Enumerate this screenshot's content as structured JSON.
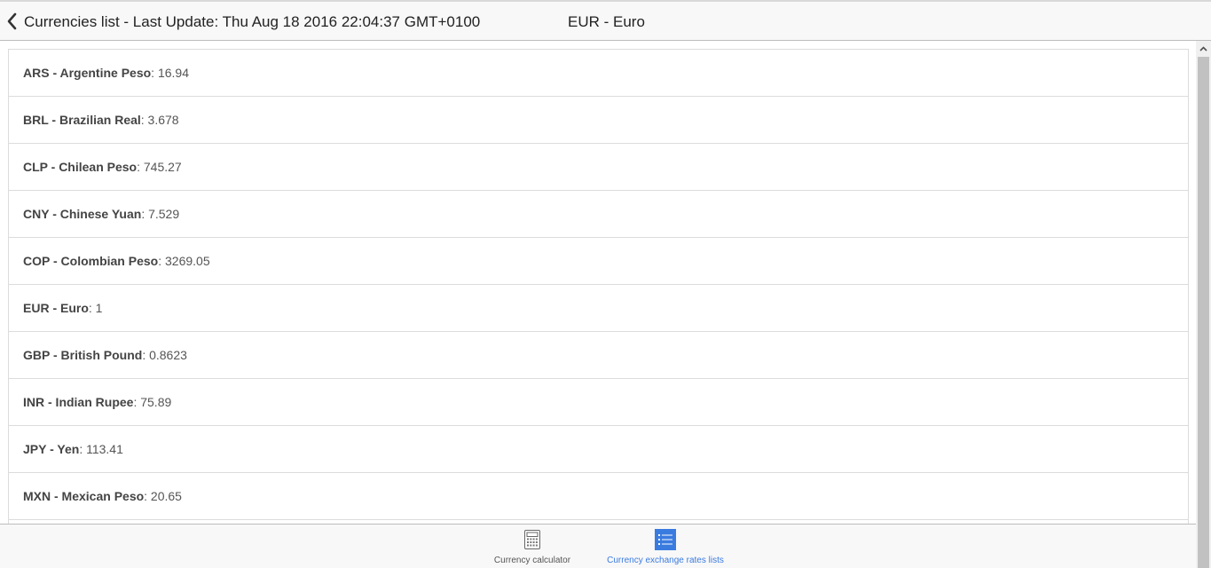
{
  "header": {
    "title": "Currencies list - Last Update: Thu Aug 18 2016 22:04:37 GMT+0100",
    "base_currency": "EUR - Euro",
    "back_icon": "chevron-left-icon"
  },
  "rates": [
    {
      "name": "ARS - Argentine Peso",
      "value": ": 16.94"
    },
    {
      "name": "BRL - Brazilian Real",
      "value": ": 3.678"
    },
    {
      "name": "CLP - Chilean Peso",
      "value": ": 745.27"
    },
    {
      "name": "CNY - Chinese Yuan",
      "value": ": 7.529"
    },
    {
      "name": "COP - Colombian Peso",
      "value": ": 3269.05"
    },
    {
      "name": "EUR - Euro",
      "value": ": 1"
    },
    {
      "name": "GBP - British Pound",
      "value": ": 0.8623"
    },
    {
      "name": "INR - Indian Rupee",
      "value": ": 75.89"
    },
    {
      "name": "JPY - Yen",
      "value": ": 113.41"
    },
    {
      "name": "MXN - Mexican Peso",
      "value": ": 20.65"
    }
  ],
  "tabs": [
    {
      "label": "Currency calculator",
      "icon": "calculator-icon",
      "active": false
    },
    {
      "label": "Currency exchange rates lists",
      "icon": "list-icon",
      "active": true
    }
  ],
  "colors": {
    "accent": "#3a7be0",
    "header_bg": "#f8f8f8",
    "border": "#dcdcdc"
  }
}
